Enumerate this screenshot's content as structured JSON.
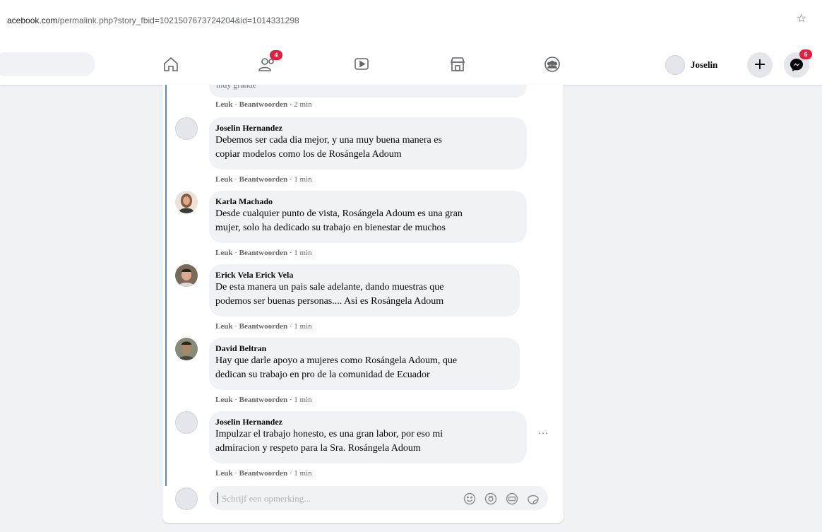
{
  "browser": {
    "url_host": "acebook.com",
    "url_path": "/permalink.php?story_fbid=1021507673724204&id=1014331298"
  },
  "nav": {
    "friends_badge": "4",
    "messenger_badge": "6",
    "profile_name": "Joselin"
  },
  "thread_top": {
    "partial_text": "muy grande"
  },
  "comments": [
    {
      "name": "Joselin Hernandez",
      "lines": [
        "Debemos ser cada dia mejor, y una muy buena manera es",
        "copiar modelos como los de Rosángela Adoum"
      ],
      "like": "Leuk",
      "reply": "Beantwoorden",
      "time": "1 min"
    },
    {
      "name": "Karla Machado",
      "lines": [
        "Desde cualquier punto de vista, Rosángela Adoum es una gran",
        "mujer, solo ha dedicado su trabajo en bienestar de muchos"
      ],
      "like": "Leuk",
      "reply": "Beantwoorden",
      "time": "1 min"
    },
    {
      "name": "Erick Vela Erick Vela",
      "lines": [
        "De esta manera un pais sale adelante, dando muestras que",
        "podemos ser buenas personas.... Asi es Rosángela Adoum"
      ],
      "like": "Leuk",
      "reply": "Beantwoorden",
      "time": "1 min"
    },
    {
      "name": "David Beltran",
      "lines": [
        "Hay que darle apoyo a mujeres como Rosángela Adoum, que",
        "dedican su trabajo en pro de la comunidad de Ecuador"
      ],
      "like": "Leuk",
      "reply": "Beantwoorden",
      "time": "1 min"
    },
    {
      "name": "Joselin Hernandez",
      "lines": [
        "Impulzar el trabajo honesto, es una gran labor, por eso mi",
        "admiracion y respeto para la Sra. Rosángela Adoum"
      ],
      "like": "Leuk",
      "reply": "Beantwoorden",
      "time": "1 min"
    }
  ],
  "first_actions": {
    "like": "Leuk",
    "reply": "Beantwoorden",
    "time": "2 min"
  },
  "composer": {
    "placeholder": "Schrijf een opmerking..."
  }
}
